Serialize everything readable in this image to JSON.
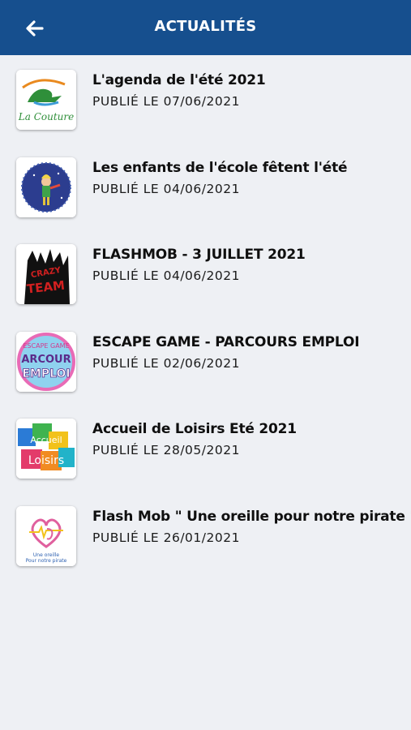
{
  "header": {
    "title": "ACTUALITÉS",
    "back_icon": "arrow-left-icon"
  },
  "colors": {
    "header_bg": "#164f8e",
    "page_bg": "#eef0f4"
  },
  "news": [
    {
      "title": "L'agenda de l'été 2021",
      "date": "PUBLIÉ LE 07/06/2021",
      "thumb_text": "La Couture"
    },
    {
      "title": "Les enfants de l'école fêtent l'été",
      "date": "PUBLIÉ LE 04/06/2021"
    },
    {
      "title": "FLASHMOB - 3 JUILLET 2021",
      "date": "PUBLIÉ LE 04/06/2021",
      "thumb_text": "CRAZY TEAM"
    },
    {
      "title": "ESCAPE GAME - PARCOURS EMPLOI",
      "date": "PUBLIÉ LE 02/06/2021",
      "thumb_text": "ESCAPE GAME PARCOURS EMPLOI"
    },
    {
      "title": "Accueil de Loisirs Eté 2021",
      "date": "PUBLIÉ LE 28/05/2021",
      "thumb_text": "Accueil de Loisirs"
    },
    {
      "title": "Flash Mob \" Une oreille pour notre pirate \"",
      "date": "PUBLIÉ LE 26/01/2021",
      "thumb_text": "Une oreille Pour notre pirate"
    }
  ]
}
